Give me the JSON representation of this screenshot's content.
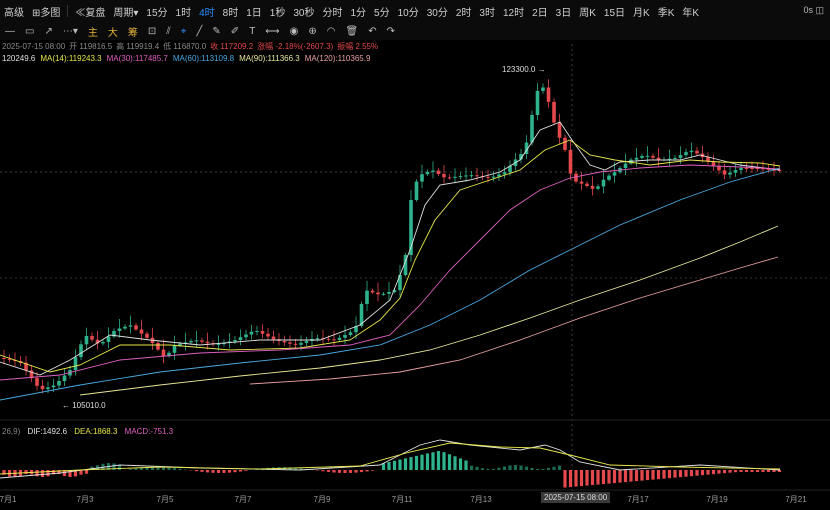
{
  "toolbar": {
    "left_items": [
      "高级",
      "多图"
    ],
    "compare_label": "复盘",
    "period_label": "周期",
    "intervals": [
      "15分",
      "1时",
      "4时",
      "8时",
      "1日",
      "1秒",
      "30秒",
      "分时",
      "1分",
      "5分",
      "10分",
      "30分",
      "2时",
      "3时",
      "12时",
      "2日",
      "3日",
      "周K",
      "15日",
      "月K",
      "季K",
      "年K"
    ],
    "active_interval": "4时",
    "right_label": "0s"
  },
  "tools": {
    "items": [
      "主",
      "大",
      "筹"
    ],
    "icons": [
      "horizontal-line-icon",
      "rectangle-icon",
      "ray-icon",
      "more-icon"
    ]
  },
  "ohlc": {
    "time": "2025-07-15 08:00",
    "open": "开 119816.5",
    "high": "高 119919.4",
    "low": "低 116870.0",
    "close": "收 117209.2",
    "change": "涨幅 -2.18%(-2607.3)",
    "amplitude": "振幅 2.55%"
  },
  "ma": [
    {
      "label": "120249.6",
      "color": "#e0e0e0"
    },
    {
      "label": "MA(14):119243.3",
      "color": "#e8e84a"
    },
    {
      "label": "MA(30):117485.7",
      "color": "#e060c0"
    },
    {
      "label": "MA(60):113109.8",
      "color": "#4aa8e0"
    },
    {
      "label": "MA(90):111366.3",
      "color": "#e8e89a"
    },
    {
      "label": "MA(120):110365.9",
      "color": "#e8a0a0"
    }
  ],
  "annotations": {
    "high": "123300.0",
    "low": "105010.0"
  },
  "macd": {
    "params": "26,9)",
    "dif": "DIF:1492.6",
    "dea": "DEA:1868.3",
    "macd": "MACD:-751.3"
  },
  "xaxis": [
    "7月1",
    "7月3",
    "7月5",
    "7月7",
    "7月9",
    "7月11",
    "7月13",
    "7月15",
    "7月17",
    "7月19",
    "7月21"
  ],
  "crosshair_label": "2025-07-15 08:00",
  "colors": {
    "up": "#2fb38f",
    "down": "#e5484d",
    "bg": "#000000",
    "accent": "#2b8cff"
  }
}
